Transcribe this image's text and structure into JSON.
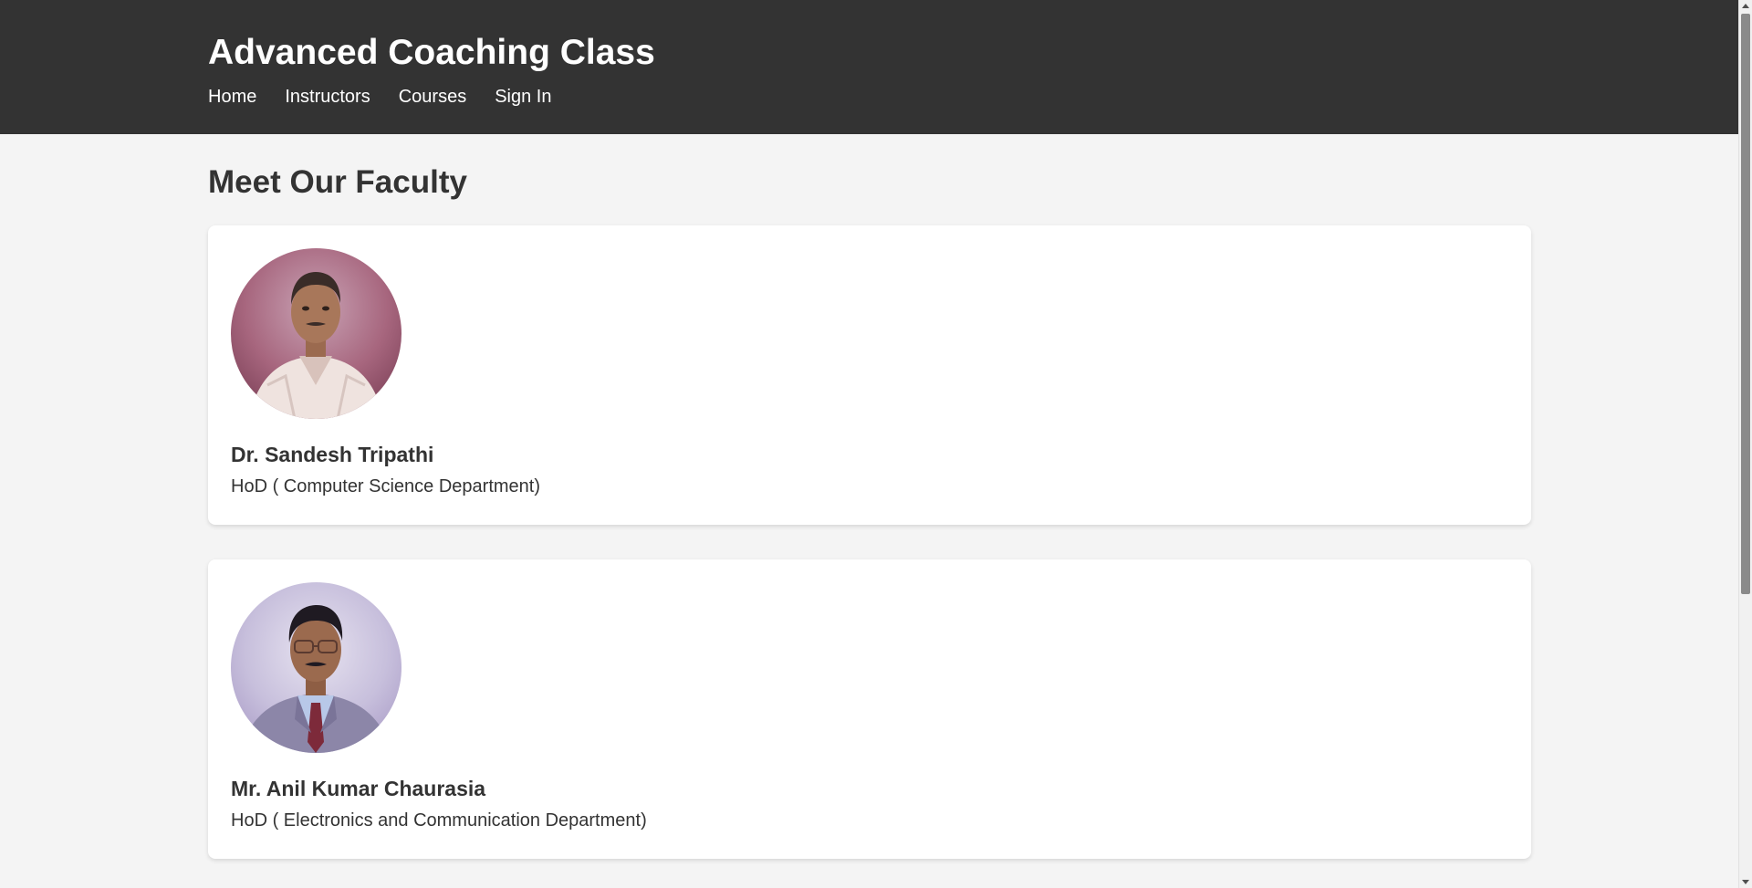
{
  "header": {
    "site_title": "Advanced Coaching Class",
    "nav": [
      "Home",
      "Instructors",
      "Courses",
      "Sign In"
    ],
    "background": "#333333"
  },
  "main": {
    "heading": "Meet Our Faculty",
    "faculty": [
      {
        "name": "Dr. Sandesh Tripathi",
        "role": "HoD ( Computer Science Department)",
        "photo": "faculty-portrait-1"
      },
      {
        "name": "Mr. Anil Kumar Chaurasia",
        "role": "HoD ( Electronics and Communication Department)",
        "photo": "faculty-portrait-2"
      }
    ]
  },
  "colors": {
    "page_background": "#f4f4f4",
    "card_background": "#ffffff",
    "text": "#333333",
    "header_text": "#ffffff"
  }
}
